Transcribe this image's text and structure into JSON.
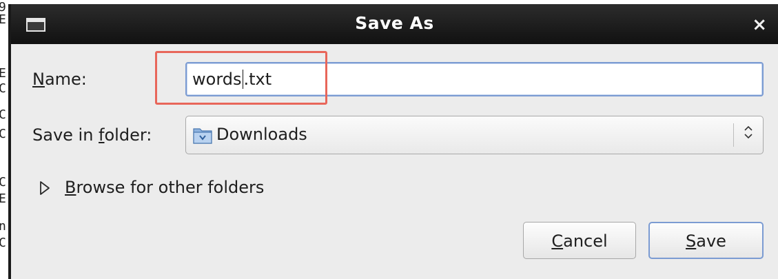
{
  "background_fragments": [
    "9",
    "E",
    "E",
    "C",
    "C",
    "C",
    "C",
    "E",
    "n",
    "C"
  ],
  "dialog": {
    "title": "Save As",
    "close_glyph": "×",
    "name_label_mnemonic": "N",
    "name_label_rest": "ame:",
    "name_value_before_cursor": "words",
    "name_value_after_cursor": ".txt",
    "folder_label_prefix": "Save in ",
    "folder_label_mnemonic": "f",
    "folder_label_rest": "older:",
    "folder_value": "Downloads",
    "browse_mnemonic": "B",
    "browse_rest": "rowse for other folders",
    "cancel_mnemonic": "C",
    "cancel_rest": "ancel",
    "save_mnemonic": "S",
    "save_rest": "ave"
  },
  "colors": {
    "highlight": "#e8665a",
    "focus_border": "#7b9bd2",
    "titlebar": "#1a1a1a"
  },
  "icons": {
    "window": "window-icon",
    "close": "close-icon",
    "folder": "folder-icon",
    "combo_arrows": "updown-arrows-icon",
    "expander": "triangle-right-icon"
  }
}
